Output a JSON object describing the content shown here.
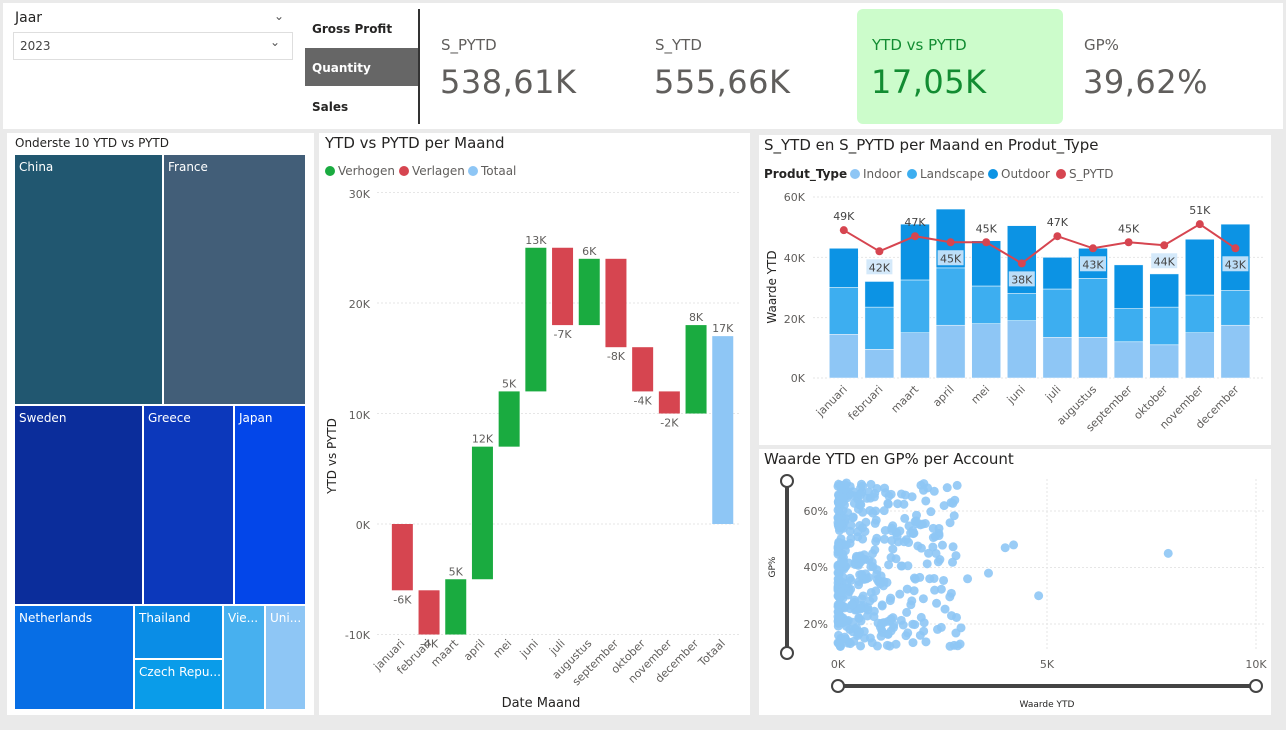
{
  "slicer": {
    "title": "Jaar",
    "value": "2023"
  },
  "measure_buttons": [
    {
      "label": "Gross Profit",
      "active": false
    },
    {
      "label": "Quantity",
      "active": true
    },
    {
      "label": "Sales",
      "active": false
    }
  ],
  "kpis": [
    {
      "label": "S_PYTD",
      "value": "538,61K"
    },
    {
      "label": "S_YTD",
      "value": "555,66K"
    },
    {
      "label": "YTD vs PYTD",
      "value": "17,05K",
      "highlight_bg": "#ccfccb",
      "highlight_fg": "#128c32"
    },
    {
      "label": "GP%",
      "value": "39,62%"
    }
  ],
  "treemap": {
    "title": "Onderste 10 YTD vs PYTD",
    "tiles": [
      {
        "label": "China",
        "color": "#215770"
      },
      {
        "label": "France",
        "color": "#425e78"
      },
      {
        "label": "Sweden",
        "color": "#0b2d9b"
      },
      {
        "label": "Greece",
        "color": "#0c38bb"
      },
      {
        "label": "Japan",
        "color": "#0346e9"
      },
      {
        "label": "Netherlands",
        "color": "#076ee5"
      },
      {
        "label": "Thailand",
        "color": "#0a8de6"
      },
      {
        "label": "Czech Repu...",
        "color": "#0a9ce9"
      },
      {
        "label": "Vie...",
        "color": "#47b0ef"
      },
      {
        "label": "Uni...",
        "color": "#8ec6f5"
      }
    ]
  },
  "waterfall": {
    "title": "YTD vs PYTD per Maand",
    "legend": [
      {
        "label": "Verhogen",
        "color": "#1aab40"
      },
      {
        "label": "Verlagen",
        "color": "#d64550"
      },
      {
        "label": "Totaal",
        "color": "#8ec6f5"
      }
    ],
    "ylabel": "YTD vs PYTD",
    "xlabel": "Date Maand",
    "yticks": [
      "30K",
      "20K",
      "10K",
      "0K",
      "-10K"
    ]
  },
  "combo": {
    "title": "S_YTD en S_PYTD per Maand en Produt_Type",
    "legend_title": "Produt_Type",
    "legend": [
      {
        "label": "Indoor",
        "color": "#8ec6f5"
      },
      {
        "label": "Landscape",
        "color": "#3daef0"
      },
      {
        "label": "Outdoor",
        "color": "#0c93e4"
      },
      {
        "label": "S_PYTD",
        "color": "#d64550"
      }
    ],
    "ylabel": "Waarde YTD",
    "yticks": [
      "60K",
      "40K",
      "20K",
      "0K"
    ]
  },
  "scatter": {
    "title": "Waarde YTD en GP% per Account",
    "ylabel": "GP%",
    "xlabel": "Waarde YTD",
    "yticks": [
      "60%",
      "40%",
      "20%"
    ],
    "xticks": [
      "0K",
      "5K",
      "10K"
    ]
  },
  "chart_data": [
    {
      "type": "bar",
      "subtype": "waterfall",
      "title": "YTD vs PYTD per Maand",
      "xlabel": "Date Maand",
      "ylabel": "YTD vs PYTD",
      "ylim": [
        -10000,
        30000
      ],
      "categories": [
        "januari",
        "februari",
        "maart",
        "april",
        "mei",
        "juni",
        "juli",
        "augustus",
        "september",
        "oktober",
        "november",
        "december",
        "Totaal"
      ],
      "values": [
        -6000,
        -4000,
        5000,
        12000,
        5000,
        13000,
        -7000,
        6000,
        -8000,
        -4000,
        -2000,
        8000,
        17000
      ],
      "labels": [
        "-6K",
        "-4K",
        "5K",
        "12K",
        "5K",
        "13K",
        "-7K",
        "6K",
        "-8K",
        "-4K",
        "-2K",
        "8K",
        "17K"
      ]
    },
    {
      "type": "bar",
      "subtype": "stacked bar + line",
      "title": "S_YTD en S_PYTD per Maand en Produt_Type",
      "ylabel": "Waarde YTD",
      "ylim": [
        0,
        60000
      ],
      "categories": [
        "januari",
        "februari",
        "maart",
        "april",
        "mei",
        "juni",
        "juli",
        "augustus",
        "september",
        "oktober",
        "november",
        "december"
      ],
      "series": [
        {
          "name": "Indoor",
          "values": [
            14500,
            9500,
            15000,
            17500,
            18000,
            19000,
            13500,
            13500,
            12000,
            11000,
            15000,
            17500
          ]
        },
        {
          "name": "Landscape",
          "values": [
            15500,
            14000,
            17500,
            19000,
            12500,
            9000,
            16000,
            19500,
            11000,
            12500,
            12500,
            11500
          ]
        },
        {
          "name": "Outdoor",
          "values": [
            13000,
            8500,
            18500,
            19500,
            15000,
            22500,
            10500,
            10000,
            14500,
            11000,
            18500,
            22000
          ]
        },
        {
          "name": "S_PYTD",
          "values": [
            49000,
            42000,
            47000,
            45000,
            45000,
            38000,
            47000,
            43000,
            45000,
            44000,
            51000,
            43000
          ]
        }
      ],
      "labels": [
        "49K",
        "42K",
        "47K",
        "45K",
        "45K",
        "38K",
        "47K",
        "43K",
        "45K",
        "44K",
        "51K",
        "43K"
      ]
    },
    {
      "type": "scatter",
      "title": "Waarde YTD en GP% per Account",
      "xlabel": "Waarde YTD",
      "ylabel": "GP%",
      "xlim": [
        0,
        10000
      ],
      "ylim": [
        0.1,
        0.7
      ],
      "points_sample": [
        [
          7900,
          0.45
        ],
        [
          4200,
          0.48
        ],
        [
          4000,
          0.47
        ],
        [
          4800,
          0.3
        ],
        [
          3600,
          0.38
        ],
        [
          3100,
          0.36
        ],
        [
          2400,
          0.42
        ],
        [
          1800,
          0.52
        ],
        [
          900,
          0.6
        ],
        [
          500,
          0.35
        ]
      ]
    }
  ]
}
